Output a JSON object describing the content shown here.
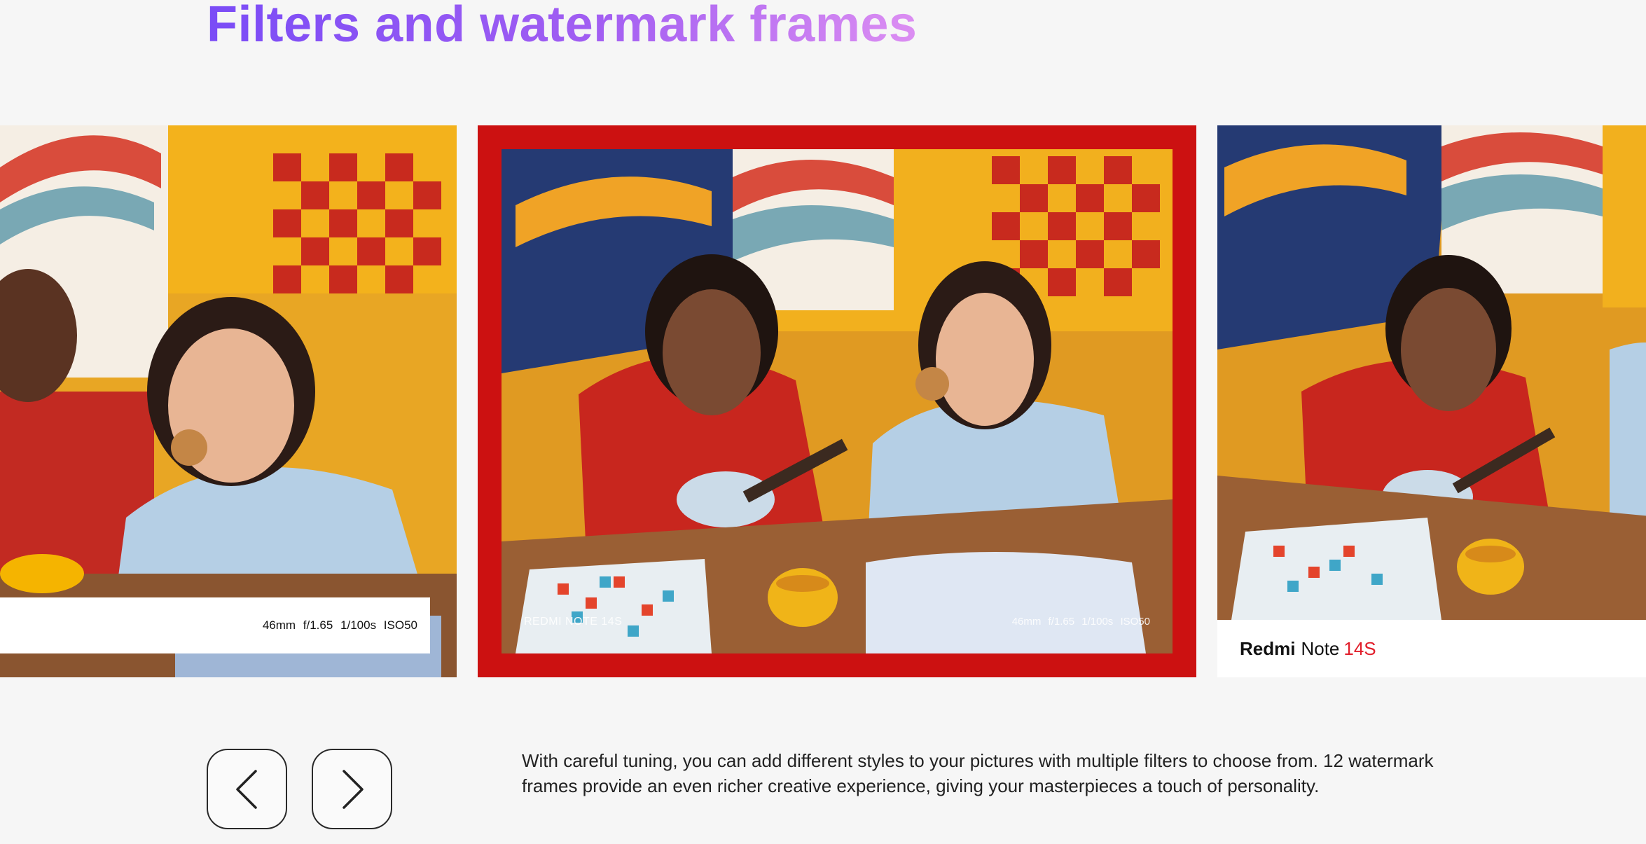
{
  "section": {
    "title": "Filters and watermark frames",
    "description": "With careful tuning, you can add different styles to your pictures with multiple filters to choose from. 12 watermark frames provide an even richer creative experience, giving your masterpieces a touch of personality."
  },
  "carousel": {
    "slides": [
      {
        "watermark_specs": "46mm f/1.65 1/100s ISO50"
      },
      {
        "frame_color": "#cc1111",
        "watermark_brand": "REDMI NOTE 14S",
        "watermark_specs": "46mm f/1.65 1/100s ISO50"
      },
      {
        "brand_part_1": "Redmi",
        "brand_part_2": "Note",
        "brand_part_3": "14S",
        "brand_accent_color": "#e11d2a"
      }
    ],
    "controls": {
      "prev_icon": "chevron-left-icon",
      "next_icon": "chevron-right-icon"
    }
  },
  "colors": {
    "title_gradient_start": "#7a4cf6",
    "title_gradient_end": "#dc8ef2",
    "background": "#f6f6f6"
  }
}
